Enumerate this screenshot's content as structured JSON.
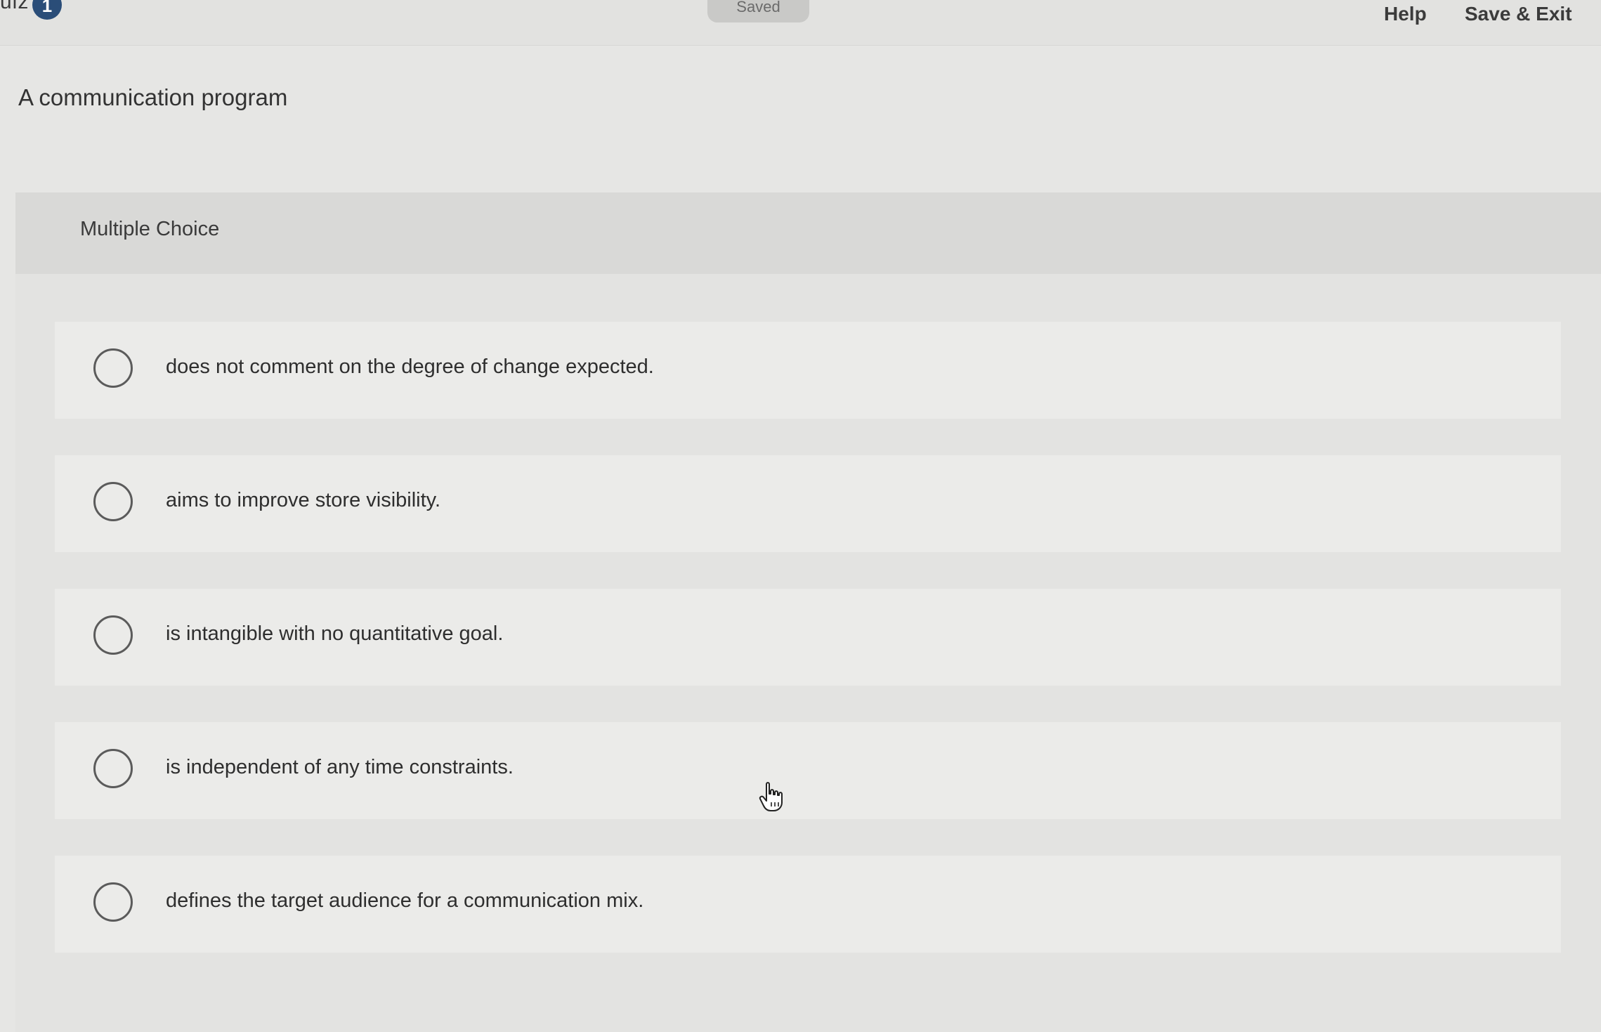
{
  "topbar": {
    "quiz_fragment": "uiz",
    "info_badge": "1",
    "saved_status": "Saved",
    "help_label": "Help",
    "save_exit_label": "Save & Exit"
  },
  "question": {
    "prompt": "A communication program",
    "type_label": "Multiple Choice",
    "options": [
      {
        "text": "does not comment on the degree of change expected."
      },
      {
        "text": "aims to improve store visibility."
      },
      {
        "text": "is intangible with no quantitative goal."
      },
      {
        "text": "is independent of any time constraints."
      },
      {
        "text": "defines the target audience for a communication mix."
      }
    ]
  },
  "icons": {
    "cursor": "hand-pointer-icon",
    "info": "info-icon",
    "radio": "radio-unchecked-icon"
  },
  "colors": {
    "badge": "#2a4d78",
    "background": "#e6e6e4",
    "option_background": "#ebebe9"
  }
}
